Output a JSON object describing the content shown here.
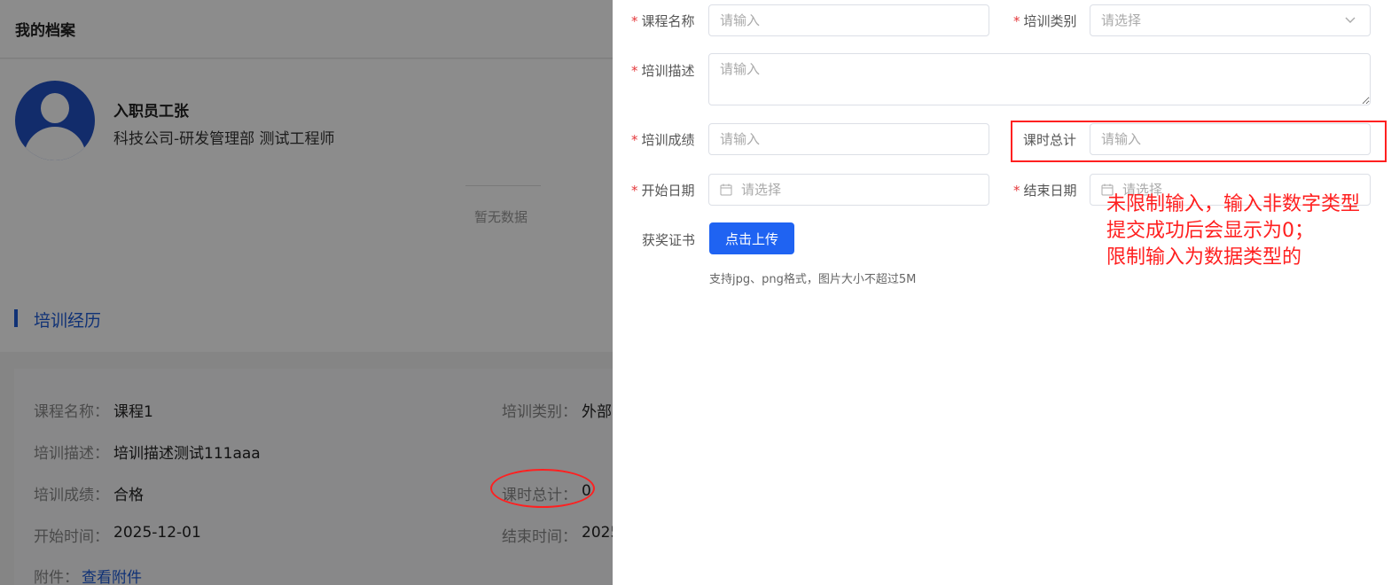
{
  "page": {
    "title": "我的档案",
    "profile": {
      "name": "入职员工张",
      "dept": "科技公司-研发管理部 测试工程师"
    },
    "no_data": "暂无数据",
    "section_title": "培训经历",
    "record": {
      "course_label": "课程名称：",
      "course_value": "课程1",
      "type_label": "培训类别：",
      "type_value": "外部",
      "desc_label": "培训描述：",
      "desc_value": "培训描述测试111aaa",
      "score_label": "培训成绩：",
      "score_value": "合格",
      "hours_label": "课时总计：",
      "hours_value": "0",
      "start_label": "开始时间：",
      "start_value": "2025-12-01",
      "end_label": "结束时间：",
      "end_value": "2025",
      "attach_label": "附件：",
      "attach_link": "查看附件"
    }
  },
  "form": {
    "course_name": {
      "label": "课程名称",
      "placeholder": "请输入"
    },
    "training_type": {
      "label": "培训类别",
      "placeholder": "请选择"
    },
    "training_desc": {
      "label": "培训描述",
      "placeholder": "请输入"
    },
    "training_score": {
      "label": "培训成绩",
      "placeholder": "请输入"
    },
    "total_hours": {
      "label": "课时总计",
      "placeholder": "请输入"
    },
    "start_date": {
      "label": "开始日期",
      "placeholder": "请选择"
    },
    "end_date": {
      "label": "结束日期",
      "placeholder": "请选择"
    },
    "certificate": {
      "label": "获奖证书",
      "button": "点击上传",
      "tip": "支持jpg、png格式，图片大小不超过5M"
    }
  },
  "annotation": {
    "line1": "未限制输入，输入非数字类型",
    "line2": "提交成功后会显示为0；",
    "line3": "限制输入为数据类型的"
  },
  "colors": {
    "primary": "#1f63f2",
    "required": "#e4393c",
    "annotation": "#ff2020"
  }
}
